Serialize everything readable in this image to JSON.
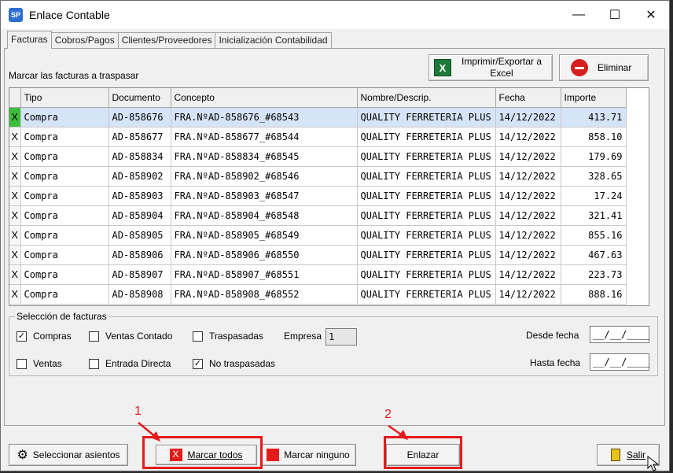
{
  "window": {
    "title": "Enlace Contable",
    "app_icon": "SP"
  },
  "tabs": [
    "Facturas",
    "Cobros/Pagos",
    "Clientes/Proveedores",
    "Inicialización Contabilidad"
  ],
  "mark_label": "Marcar las facturas a traspasar",
  "toolbar": {
    "export_label_1": "Imprimir/Exportar a",
    "export_label_2": "Excel",
    "delete_label": "Eliminar"
  },
  "table": {
    "columns": [
      "Tipo",
      "Documento",
      "Concepto",
      "Nombre/Descrip.",
      "Fecha",
      "Importe"
    ],
    "rows": [
      {
        "sel": "X",
        "tipo": "Compra",
        "doc": "AD-858676",
        "concepto": "FRA.NºAD-858676_#68543",
        "nombre": "QUALITY FERRETERIA PLUS",
        "fecha": "14/12/2022",
        "importe": "413.71"
      },
      {
        "sel": "X",
        "tipo": "Compra",
        "doc": "AD-858677",
        "concepto": "FRA.NºAD-858677_#68544",
        "nombre": "QUALITY FERRETERIA PLUS",
        "fecha": "14/12/2022",
        "importe": "858.10"
      },
      {
        "sel": "X",
        "tipo": "Compra",
        "doc": "AD-858834",
        "concepto": "FRA.NºAD-858834_#68545",
        "nombre": "QUALITY FERRETERIA PLUS",
        "fecha": "14/12/2022",
        "importe": "179.69"
      },
      {
        "sel": "X",
        "tipo": "Compra",
        "doc": "AD-858902",
        "concepto": "FRA.NºAD-858902_#68546",
        "nombre": "QUALITY FERRETERIA PLUS",
        "fecha": "14/12/2022",
        "importe": "328.65"
      },
      {
        "sel": "X",
        "tipo": "Compra",
        "doc": "AD-858903",
        "concepto": "FRA.NºAD-858903_#68547",
        "nombre": "QUALITY FERRETERIA PLUS",
        "fecha": "14/12/2022",
        "importe": "17.24"
      },
      {
        "sel": "X",
        "tipo": "Compra",
        "doc": "AD-858904",
        "concepto": "FRA.NºAD-858904_#68548",
        "nombre": "QUALITY FERRETERIA PLUS",
        "fecha": "14/12/2022",
        "importe": "321.41"
      },
      {
        "sel": "X",
        "tipo": "Compra",
        "doc": "AD-858905",
        "concepto": "FRA.NºAD-858905_#68549",
        "nombre": "QUALITY FERRETERIA PLUS",
        "fecha": "14/12/2022",
        "importe": "855.16"
      },
      {
        "sel": "X",
        "tipo": "Compra",
        "doc": "AD-858906",
        "concepto": "FRA.NºAD-858906_#68550",
        "nombre": "QUALITY FERRETERIA PLUS",
        "fecha": "14/12/2022",
        "importe": "467.63"
      },
      {
        "sel": "X",
        "tipo": "Compra",
        "doc": "AD-858907",
        "concepto": "FRA.NºAD-858907_#68551",
        "nombre": "QUALITY FERRETERIA PLUS",
        "fecha": "14/12/2022",
        "importe": "223.73"
      },
      {
        "sel": "X",
        "tipo": "Compra",
        "doc": "AD-858908",
        "concepto": "FRA.NºAD-858908_#68552",
        "nombre": "QUALITY FERRETERIA PLUS",
        "fecha": "14/12/2022",
        "importe": "888.16"
      }
    ]
  },
  "filters": {
    "group_title": "Selección de facturas",
    "compras": {
      "label": "Compras",
      "checked": "✓"
    },
    "ventas_contado": {
      "label": "Ventas Contado",
      "checked": ""
    },
    "traspasadas": {
      "label": "Traspasadas",
      "checked": ""
    },
    "ventas": {
      "label": "Ventas",
      "checked": ""
    },
    "entrada_directa": {
      "label": "Entrada Directa",
      "checked": ""
    },
    "no_traspasadas": {
      "label": "No traspasadas",
      "checked": "✓"
    },
    "empresa_label": "Empresa",
    "empresa_value": "1",
    "desde_label": "Desde fecha",
    "desde_value": "__/__/____",
    "hasta_label": "Hasta fecha",
    "hasta_value": "__/__/____"
  },
  "bottom": {
    "seleccionar": "Seleccionar asientos",
    "marcar_todos": "Marcar todos",
    "marcar_ninguno": "Marcar ninguno",
    "enlazar": "Enlazar",
    "salir": "Salir"
  },
  "annotations": {
    "one": "1",
    "two": "2"
  },
  "colors": {
    "highlight": "#e41b1b",
    "selected_row": "#d6e4f7",
    "mark_green": "#3dbf3d"
  }
}
